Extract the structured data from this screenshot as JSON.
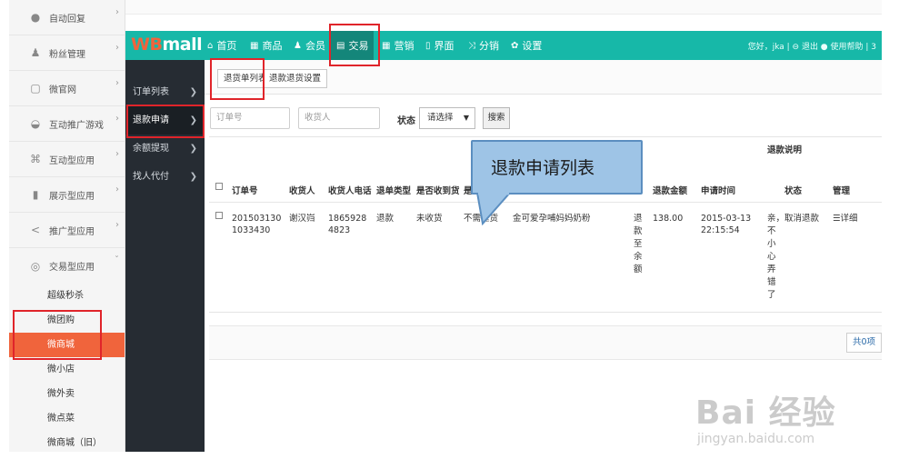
{
  "outer_sidebar": {
    "items": [
      {
        "label": "自动回复",
        "icon": "comment-icon"
      },
      {
        "label": "粉丝管理",
        "icon": "users-icon"
      },
      {
        "label": "微官网",
        "icon": "page-icon"
      },
      {
        "label": "互动推广游戏",
        "icon": "gamepad-icon"
      },
      {
        "label": "互动型应用",
        "icon": "command-icon"
      },
      {
        "label": "展示型应用",
        "icon": "book-icon"
      },
      {
        "label": "推广型应用",
        "icon": "share-icon"
      },
      {
        "label": "交易型应用",
        "icon": "coin-icon"
      }
    ],
    "sub_items": [
      "超级秒杀",
      "微团购",
      "微商城",
      "微小店",
      "微外卖",
      "微点菜",
      "微商城（旧）"
    ],
    "active_sub": "微商城"
  },
  "header": {
    "logo_prefix": "WB",
    "logo_suffix": "mall",
    "nav": [
      "首页",
      "商品",
      "会员",
      "交易",
      "营销",
      "界面",
      "分销",
      "设置"
    ],
    "active_nav": "交易",
    "right_text": "您好，jka  |  ⊖ 退出  ● 使用帮助  |  3"
  },
  "dark_sidebar": {
    "items": [
      "订单列表",
      "退款申请",
      "余额提现",
      "找人代付"
    ],
    "active": "退款申请"
  },
  "subtabs": [
    "退货单列表",
    "退款退货设置"
  ],
  "filters": {
    "order_no_placeholder": "订单号",
    "receiver_placeholder": "收货人",
    "status_label": "状态",
    "status_value": "请选择",
    "search_label": "搜索"
  },
  "table": {
    "headers": [
      "订单号",
      "收货人",
      "收货人电话",
      "退单类型",
      "是否收到货",
      "是",
      "退款金额",
      "申请时间",
      "退款说明",
      "状态",
      "管理"
    ],
    "rows": [
      {
        "order_no": "2015031301033430",
        "receiver": "谢汉岿",
        "phone": "18659284823",
        "type": "退款",
        "received": "未收货",
        "return_goods": "不需退货",
        "product": "金可爱孕哺妈妈奶粉",
        "reason": "退款至余额",
        "amount": "138.00",
        "apply_time": "2015-03-13 22:15:54",
        "note": "亲，不小心弄错了",
        "status": "取消退款",
        "action": "详细"
      }
    ]
  },
  "pager_text": "共0项",
  "callout_text": "退款申请列表",
  "watermark": {
    "main": "Bai 经验",
    "sub": "jingyan.baidu.com"
  },
  "colors": {
    "teal": "#17b8a8",
    "orange": "#f0643c",
    "dark": "#262c33",
    "annotation_red": "#e0242a",
    "callout_blue": "#9ec4e6"
  }
}
